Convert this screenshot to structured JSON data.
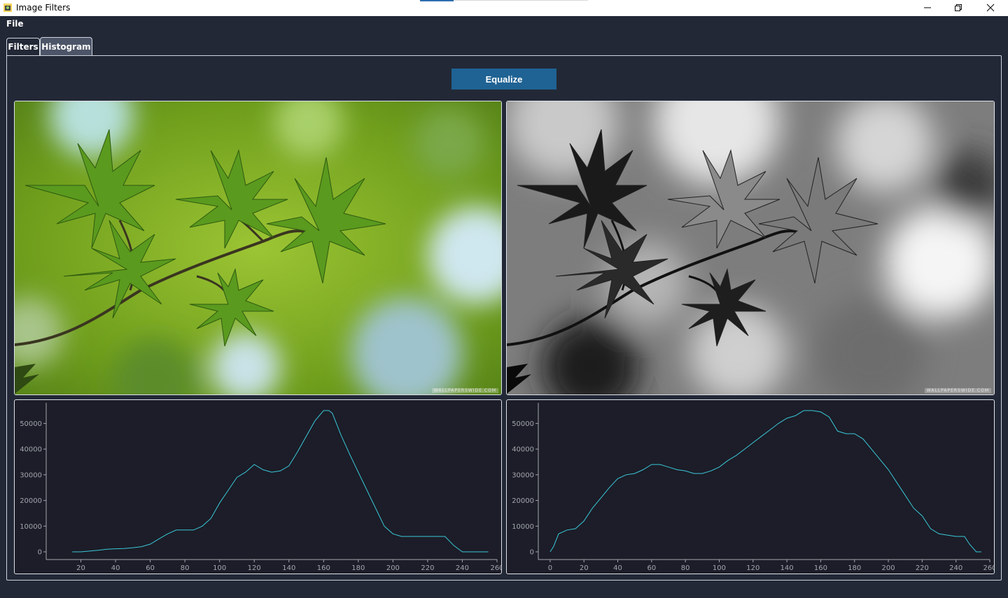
{
  "window": {
    "title": "Image Filters",
    "icons": {
      "app": "app-icon",
      "minimize": "minimize-icon",
      "restore": "restore-icon",
      "close": "close-icon"
    }
  },
  "menu": {
    "file_label": "File"
  },
  "tabs": [
    {
      "label": "Filters",
      "active": false
    },
    {
      "label": "Histogram",
      "active": true
    }
  ],
  "equalize_label": "Equalize",
  "images": {
    "original": {
      "watermark": "WALLPAPERSWIDE.COM"
    },
    "equalized": {
      "watermark": "WALLPAPERSWIDE.COM"
    }
  },
  "colors": {
    "line": "#3ac7d8",
    "accent_button": "#1f6394",
    "background": "#222836",
    "plot_bg": "#1c1d28"
  },
  "chart_data": [
    {
      "type": "line",
      "x": [
        15,
        20,
        25,
        30,
        35,
        40,
        45,
        50,
        55,
        60,
        65,
        70,
        75,
        80,
        85,
        90,
        95,
        100,
        105,
        110,
        115,
        120,
        125,
        130,
        135,
        140,
        145,
        150,
        155,
        160,
        163,
        165,
        170,
        175,
        180,
        185,
        190,
        195,
        200,
        205,
        210,
        215,
        220,
        225,
        230,
        235,
        240,
        245,
        250,
        255
      ],
      "y": [
        0,
        0,
        300,
        600,
        1000,
        1200,
        1300,
        1600,
        2000,
        3000,
        5000,
        7000,
        8500,
        8500,
        8500,
        10000,
        13000,
        19000,
        24000,
        29000,
        31000,
        34000,
        32000,
        31000,
        31500,
        33500,
        39000,
        45000,
        51000,
        55000,
        55000,
        54000,
        45500,
        38000,
        31000,
        24000,
        17000,
        10000,
        7000,
        6000,
        6000,
        6000,
        6000,
        6000,
        6000,
        2500,
        0,
        0,
        0,
        0
      ],
      "xticks": [
        "20",
        "40",
        "60",
        "80",
        "100",
        "120",
        "140",
        "160",
        "180",
        "200",
        "220",
        "240",
        "260"
      ],
      "yticks": [
        "0",
        "10000",
        "20000",
        "30000",
        "40000",
        "50000"
      ],
      "xlim": [
        0,
        260
      ],
      "ylim": [
        -3000,
        58000
      ]
    },
    {
      "type": "line",
      "x": [
        0,
        2,
        5,
        10,
        15,
        20,
        25,
        30,
        35,
        40,
        45,
        50,
        55,
        60,
        65,
        70,
        75,
        80,
        85,
        90,
        95,
        100,
        105,
        110,
        115,
        120,
        125,
        130,
        135,
        140,
        145,
        150,
        155,
        160,
        165,
        170,
        175,
        180,
        185,
        190,
        195,
        200,
        205,
        210,
        215,
        220,
        225,
        230,
        235,
        240,
        245,
        248,
        252,
        255
      ],
      "y": [
        0,
        2000,
        7000,
        8500,
        9000,
        12000,
        17000,
        21000,
        25000,
        28500,
        30000,
        30500,
        32000,
        34000,
        34000,
        33000,
        32000,
        31500,
        30500,
        30500,
        31500,
        33000,
        35500,
        37500,
        40000,
        42500,
        45000,
        47500,
        50000,
        52000,
        53000,
        55000,
        55000,
        54500,
        52500,
        47000,
        46000,
        46000,
        44000,
        40000,
        36000,
        32000,
        27000,
        22000,
        17000,
        14000,
        9000,
        7000,
        6500,
        6000,
        6000,
        3000,
        0,
        0
      ],
      "xticks": [
        "0",
        "20",
        "40",
        "60",
        "80",
        "100",
        "120",
        "140",
        "160",
        "180",
        "200",
        "220",
        "240",
        "260"
      ],
      "yticks": [
        "0",
        "10000",
        "20000",
        "30000",
        "40000",
        "50000"
      ],
      "xlim": [
        -7,
        260
      ],
      "ylim": [
        -3000,
        58000
      ]
    }
  ]
}
